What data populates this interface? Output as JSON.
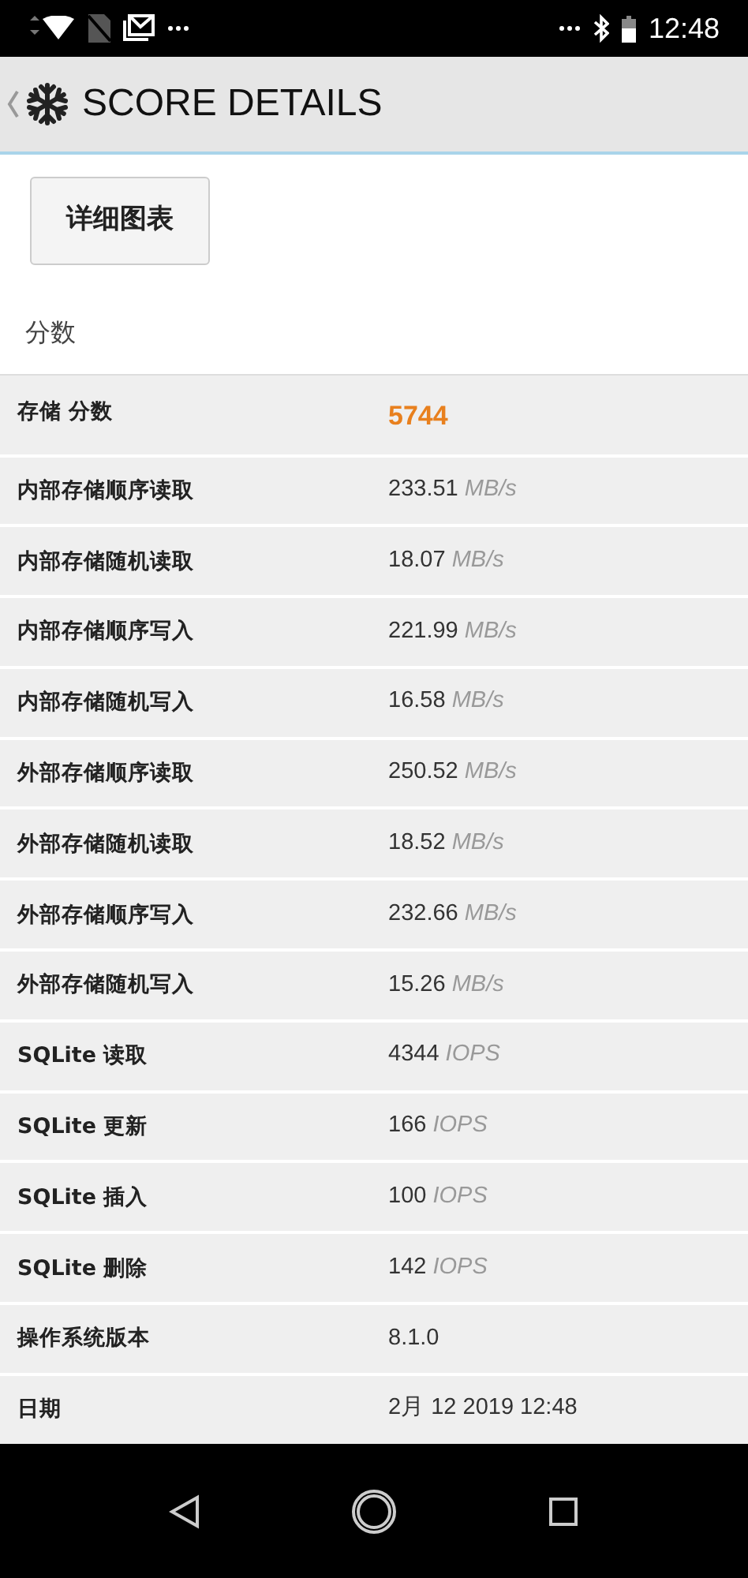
{
  "status_bar": {
    "time": "12:48"
  },
  "app_bar": {
    "title": "SCORE DETAILS"
  },
  "chart_button": {
    "label": "详细图表"
  },
  "section_label": "分数",
  "rows": [
    {
      "kind": "score",
      "label": "存储 分数",
      "value": "5744"
    },
    {
      "kind": "metric",
      "label": "内部存储顺序读取",
      "value": "233.51",
      "unit": "MB/s"
    },
    {
      "kind": "metric",
      "label": "内部存储随机读取",
      "value": "18.07",
      "unit": "MB/s"
    },
    {
      "kind": "metric",
      "label": "内部存储顺序写入",
      "value": "221.99",
      "unit": "MB/s"
    },
    {
      "kind": "metric",
      "label": "内部存储随机写入",
      "value": "16.58",
      "unit": "MB/s"
    },
    {
      "kind": "metric",
      "label": "外部存储顺序读取",
      "value": "250.52",
      "unit": "MB/s"
    },
    {
      "kind": "metric",
      "label": "外部存储随机读取",
      "value": "18.52",
      "unit": "MB/s"
    },
    {
      "kind": "metric",
      "label": "外部存储顺序写入",
      "value": "232.66",
      "unit": "MB/s"
    },
    {
      "kind": "metric",
      "label": "外部存储随机写入",
      "value": "15.26",
      "unit": "MB/s"
    },
    {
      "kind": "metric",
      "label": "SQLite 读取",
      "value": "4344",
      "unit": "IOPS"
    },
    {
      "kind": "metric",
      "label": "SQLite 更新",
      "value": "166",
      "unit": "IOPS"
    },
    {
      "kind": "metric",
      "label": "SQLite 插入",
      "value": "100",
      "unit": "IOPS"
    },
    {
      "kind": "metric",
      "label": "SQLite 删除",
      "value": "142",
      "unit": "IOPS"
    },
    {
      "kind": "metric",
      "label": "操作系统版本",
      "value": "8.1.0"
    },
    {
      "kind": "metric",
      "label": "日期",
      "value": "2月 12 2019 12:48"
    }
  ]
}
